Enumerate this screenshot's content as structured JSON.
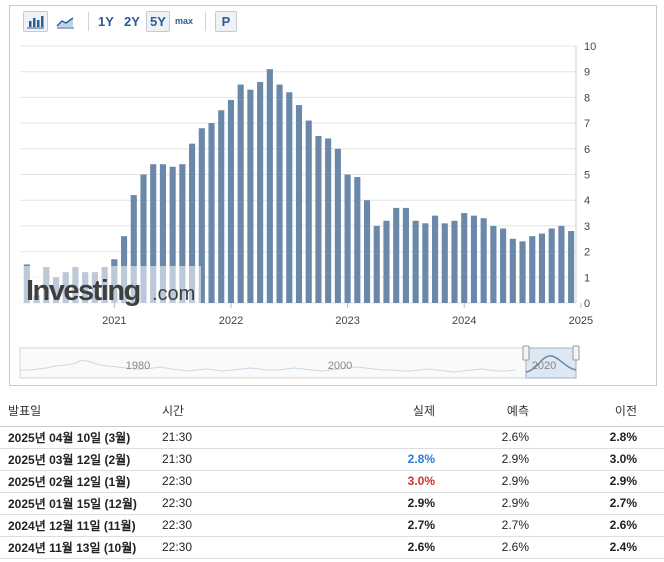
{
  "toolbar": {
    "bar_icon": "bar-chart-icon",
    "area_icon": "area-chart-icon",
    "range_1y": "1Y",
    "range_2y": "2Y",
    "range_5y": "5Y",
    "range_max": "max",
    "p_button": "P",
    "active_range": "5Y"
  },
  "watermark": {
    "main": "Investing",
    "suffix": ".com"
  },
  "colors": {
    "bar": "#6a88aa",
    "faded_bar": "#b7c8dc",
    "grid": "#e4e4e4",
    "positive": "#2d7dd2",
    "negative": "#d0302d",
    "navigator_fill": "#dde8f4"
  },
  "chart_data": {
    "type": "bar",
    "y_axis": {
      "min": 0,
      "max": 10,
      "ticks": [
        "0",
        "1",
        "2",
        "3",
        "4",
        "5",
        "6",
        "7",
        "8",
        "9",
        "10"
      ],
      "position": "right"
    },
    "x_tick_labels": [
      "2021",
      "2022",
      "2023",
      "2024",
      "2025"
    ],
    "grid": true,
    "start_month": "2020-04",
    "values": [
      1.5,
      0.3,
      1.4,
      1.0,
      1.2,
      1.4,
      1.2,
      1.2,
      1.4,
      1.7,
      2.6,
      4.2,
      5.0,
      5.4,
      5.4,
      5.3,
      5.4,
      6.2,
      6.8,
      7.0,
      7.5,
      7.9,
      8.5,
      8.3,
      8.6,
      9.1,
      8.5,
      8.2,
      7.7,
      7.1,
      6.5,
      6.4,
      6.0,
      5.0,
      4.9,
      4.0,
      3.0,
      3.2,
      3.7,
      3.7,
      3.2,
      3.1,
      3.4,
      3.1,
      3.2,
      3.5,
      3.4,
      3.3,
      3.0,
      2.9,
      2.5,
      2.4,
      2.6,
      2.7,
      2.9,
      3.0,
      2.8
    ],
    "navigator": {
      "labels": [
        "1980",
        "2000",
        "2020"
      ]
    }
  },
  "table": {
    "headers": {
      "date": "발표일",
      "time": "시간",
      "actual": "실제",
      "forecast": "예측",
      "previous": "이전"
    },
    "rows": [
      {
        "date": "2025년 04월 10일 (3월)",
        "time": "21:30",
        "actual": "",
        "actual_color": "",
        "forecast": "2.6%",
        "previous": "2.8%"
      },
      {
        "date": "2025년 03월 12일 (2월)",
        "time": "21:30",
        "actual": "2.8%",
        "actual_color": "#2d7dd2",
        "forecast": "2.9%",
        "previous": "3.0%"
      },
      {
        "date": "2025년 02월 12일 (1월)",
        "time": "22:30",
        "actual": "3.0%",
        "actual_color": "#d0302d",
        "forecast": "2.9%",
        "previous": "2.9%"
      },
      {
        "date": "2025년 01월 15일 (12월)",
        "time": "22:30",
        "actual": "2.9%",
        "actual_color": "",
        "forecast": "2.9%",
        "previous": "2.7%"
      },
      {
        "date": "2024년 12월 11일 (11월)",
        "time": "22:30",
        "actual": "2.7%",
        "actual_color": "",
        "forecast": "2.7%",
        "previous": "2.6%"
      },
      {
        "date": "2024년 11월 13일 (10월)",
        "time": "22:30",
        "actual": "2.6%",
        "actual_color": "",
        "forecast": "2.6%",
        "previous": "2.4%"
      }
    ]
  }
}
